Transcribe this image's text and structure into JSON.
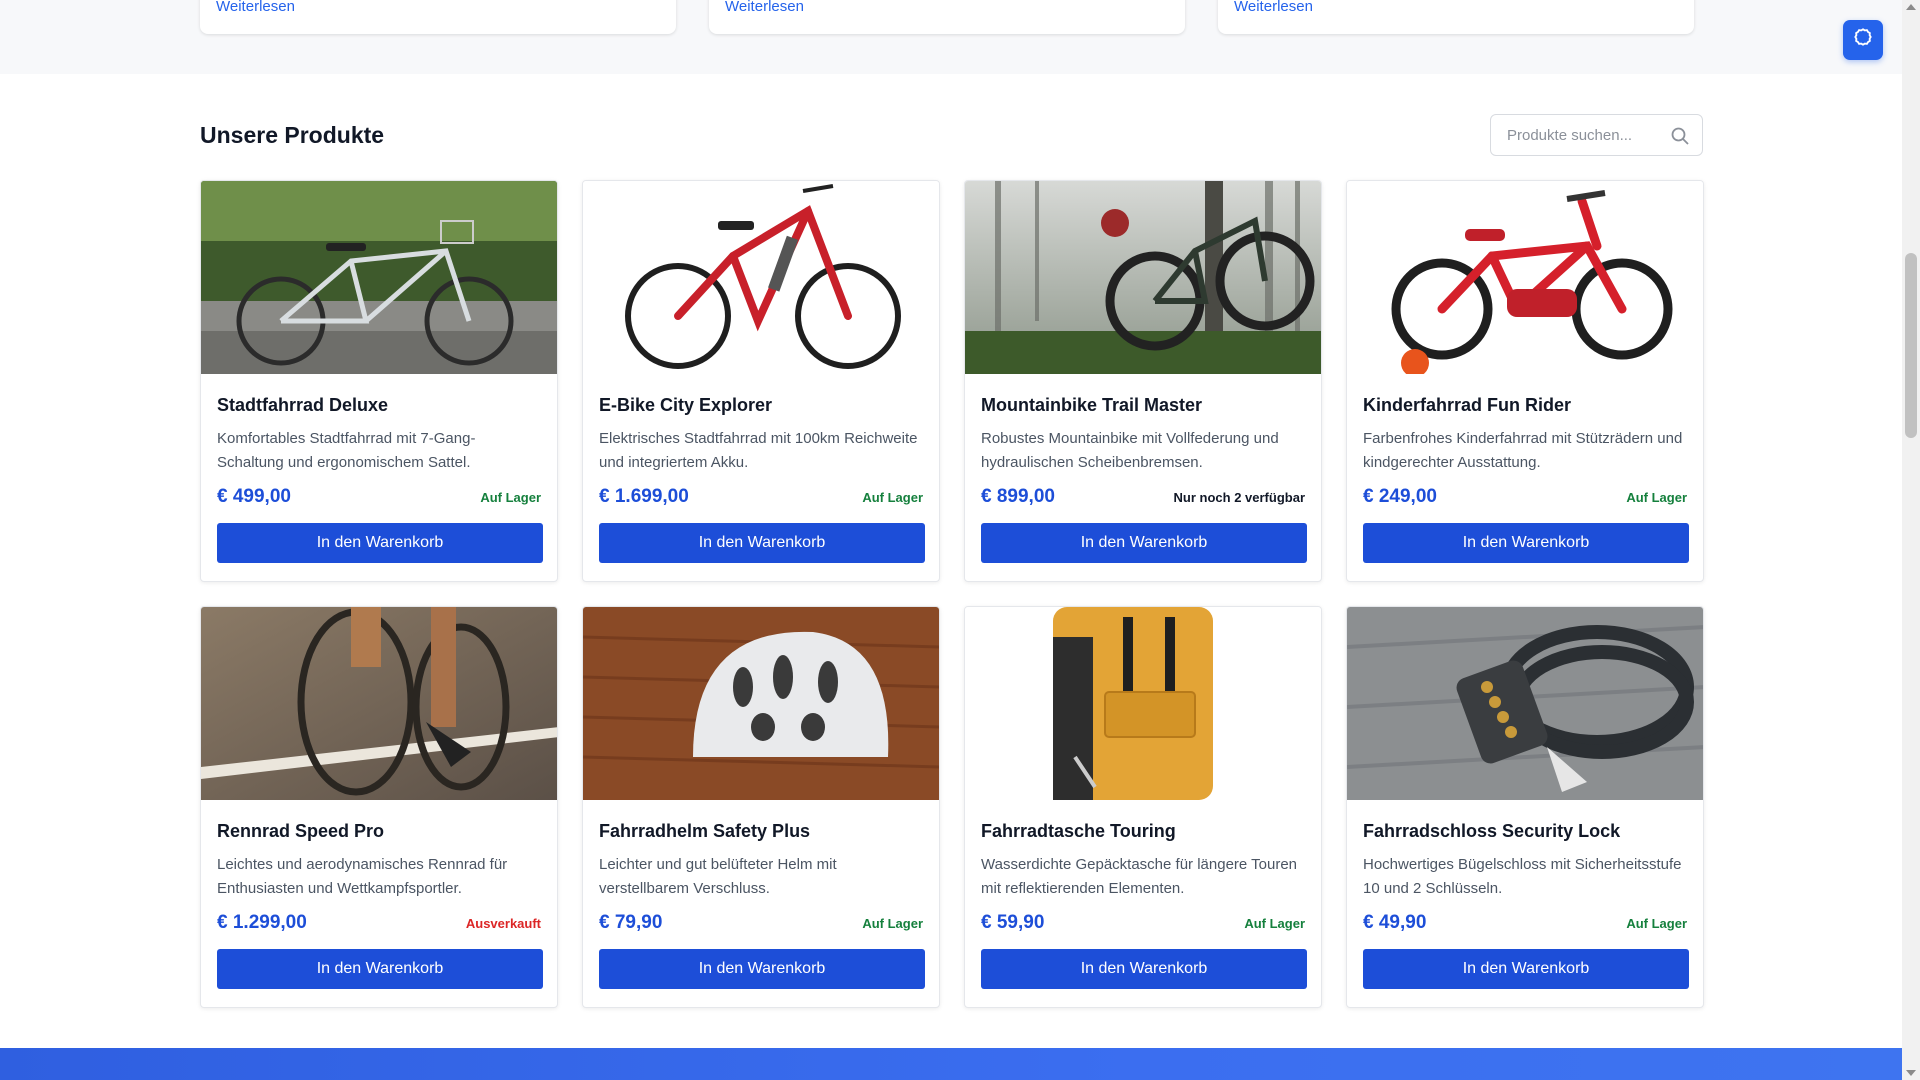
{
  "blog": {
    "read_more": [
      "Weiterlesen",
      "Weiterlesen",
      "Weiterlesen"
    ]
  },
  "section": {
    "title": "Unsere Produkte"
  },
  "search": {
    "placeholder": "Produkte suchen..."
  },
  "products": [
    {
      "name": "Stadtfahrrad Deluxe",
      "desc": "Komfortables Stadtfahrrad mit 7-Gang-Schaltung und ergonomischem Sattel.",
      "price": "€ 499,00",
      "stock": "Auf Lager",
      "button": "In den Warenkorb"
    },
    {
      "name": "E-Bike City Explorer",
      "desc": "Elektrisches Stadtfahrrad mit 100km Reichweite und integriertem Akku.",
      "price": "€ 1.699,00",
      "stock": "Auf Lager",
      "button": "In den Warenkorb"
    },
    {
      "name": "Mountainbike Trail Master",
      "desc": "Robustes Mountainbike mit Vollfederung und hydraulischen Scheibenbremsen.",
      "price": "€ 899,00",
      "stock": "Nur noch 2 verfügbar",
      "button": "In den Warenkorb"
    },
    {
      "name": "Kinderfahrrad Fun Rider",
      "desc": "Farbenfrohes Kinderfahrrad mit Stützrädern und kindgerechter Ausstattung.",
      "price": "€ 249,00",
      "stock": "Auf Lager",
      "button": "In den Warenkorb"
    },
    {
      "name": "Rennrad Speed Pro",
      "desc": "Leichtes und aerodynamisches Rennrad für Enthusiasten und Wettkampfsportler.",
      "price": "€ 1.299,00",
      "stock": "Ausverkauft",
      "button": "In den Warenkorb"
    },
    {
      "name": "Fahrradhelm Safety Plus",
      "desc": "Leichter und gut belüfteter Helm mit verstellbarem Verschluss.",
      "price": "€ 79,90",
      "stock": "Auf Lager",
      "button": "In den Warenkorb"
    },
    {
      "name": "Fahrradtasche Touring",
      "desc": "Wasserdichte Gepäcktasche für längere Touren mit reflektierenden Elementen.",
      "price": "€ 59,90",
      "stock": "Auf Lager",
      "button": "In den Warenkorb"
    },
    {
      "name": "Fahrradschloss Security Lock",
      "desc": "Hochwertiges Bügelschloss mit Sicherheitsstufe 10 und 2 Schlüsseln.",
      "price": "€ 49,90",
      "stock": "Auf Lager",
      "button": "In den Warenkorb"
    }
  ],
  "icons": {
    "settings": "gear-icon",
    "search": "search-icon"
  },
  "colors": {
    "accent": "#1d4ed8",
    "in_stock": "#15803d",
    "sold_out": "#dc2626",
    "low_stock": "#111827"
  }
}
